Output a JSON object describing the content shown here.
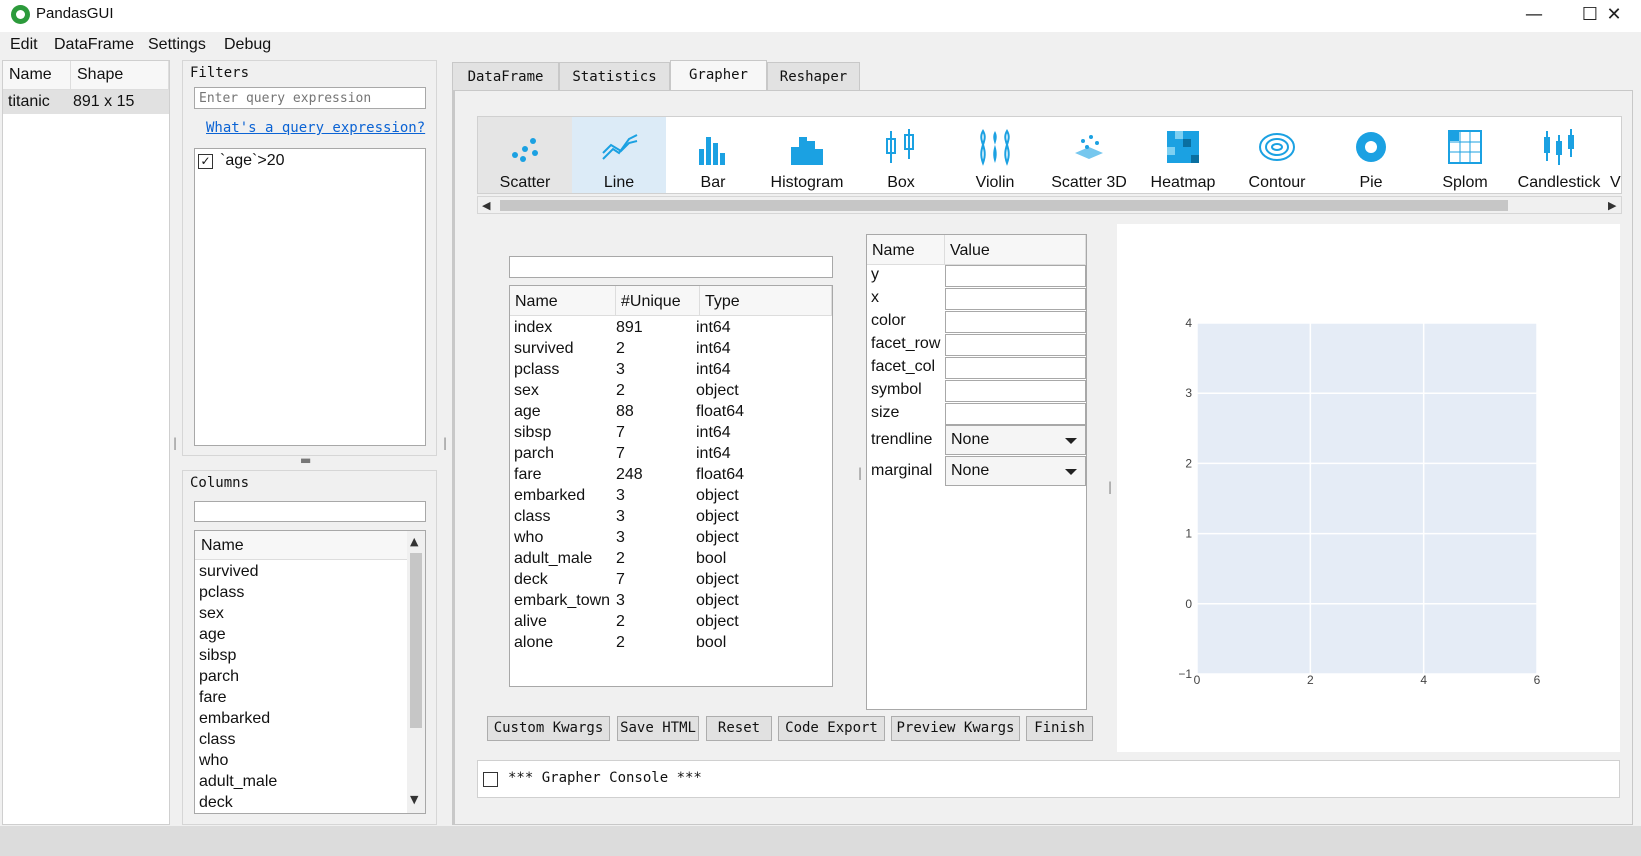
{
  "window": {
    "title": "PandasGUI",
    "controls": [
      "—",
      "☐",
      "✕"
    ]
  },
  "menu": [
    "Edit",
    "DataFrame",
    "Settings",
    "Debug"
  ],
  "dataframes": {
    "headers": [
      "Name",
      "Shape"
    ],
    "rows": [
      {
        "name": "titanic",
        "shape": "891 x 15"
      }
    ]
  },
  "filters": {
    "title": "Filters",
    "placeholder": "Enter query expression",
    "help_link": "What's a query expression?",
    "items": [
      {
        "label": "`age`>20",
        "checked": true
      }
    ]
  },
  "columns_panel": {
    "title": "Columns",
    "header": "Name",
    "items": [
      "survived",
      "pclass",
      "sex",
      "age",
      "sibsp",
      "parch",
      "fare",
      "embarked",
      "class",
      "who",
      "adult_male",
      "deck"
    ]
  },
  "tabs": [
    "DataFrame",
    "Statistics",
    "Grapher",
    "Reshaper"
  ],
  "active_tab": "Grapher",
  "chart_types": [
    "Scatter",
    "Line",
    "Bar",
    "Histogram",
    "Box",
    "Violin",
    "Scatter 3D",
    "Heatmap",
    "Contour",
    "Pie",
    "Splom",
    "Candlestick",
    "V"
  ],
  "data_columns": {
    "headers": [
      "Name",
      "#Unique",
      "Type"
    ],
    "rows": [
      [
        "index",
        "891",
        "int64"
      ],
      [
        "survived",
        "2",
        "int64"
      ],
      [
        "pclass",
        "3",
        "int64"
      ],
      [
        "sex",
        "2",
        "object"
      ],
      [
        "age",
        "88",
        "float64"
      ],
      [
        "sibsp",
        "7",
        "int64"
      ],
      [
        "parch",
        "7",
        "int64"
      ],
      [
        "fare",
        "248",
        "float64"
      ],
      [
        "embarked",
        "3",
        "object"
      ],
      [
        "class",
        "3",
        "object"
      ],
      [
        "who",
        "3",
        "object"
      ],
      [
        "adult_male",
        "2",
        "bool"
      ],
      [
        "deck",
        "7",
        "object"
      ],
      [
        "embark_town",
        "3",
        "object"
      ],
      [
        "alive",
        "2",
        "object"
      ],
      [
        "alone",
        "2",
        "bool"
      ]
    ]
  },
  "kwargs": {
    "headers": [
      "Name",
      "Value"
    ],
    "fields": [
      "y",
      "x",
      "color",
      "facet_row",
      "facet_col",
      "symbol",
      "size"
    ],
    "dropdowns": [
      {
        "name": "trendline",
        "value": "None"
      },
      {
        "name": "marginal",
        "value": "None"
      }
    ]
  },
  "buttons": [
    "Custom Kwargs",
    "Save HTML",
    "Reset",
    "Code Export",
    "Preview Kwargs",
    "Finish"
  ],
  "console": {
    "label": "*** Grapher Console ***",
    "checked": false
  },
  "plot": {
    "x_ticks": [
      "0",
      "2",
      "4",
      "6"
    ],
    "y_ticks": [
      "4",
      "3",
      "2",
      "1",
      "0",
      "−1"
    ]
  },
  "colors": {
    "accent": "#1ba1e2",
    "plot_bg": "#e5ecf6"
  }
}
